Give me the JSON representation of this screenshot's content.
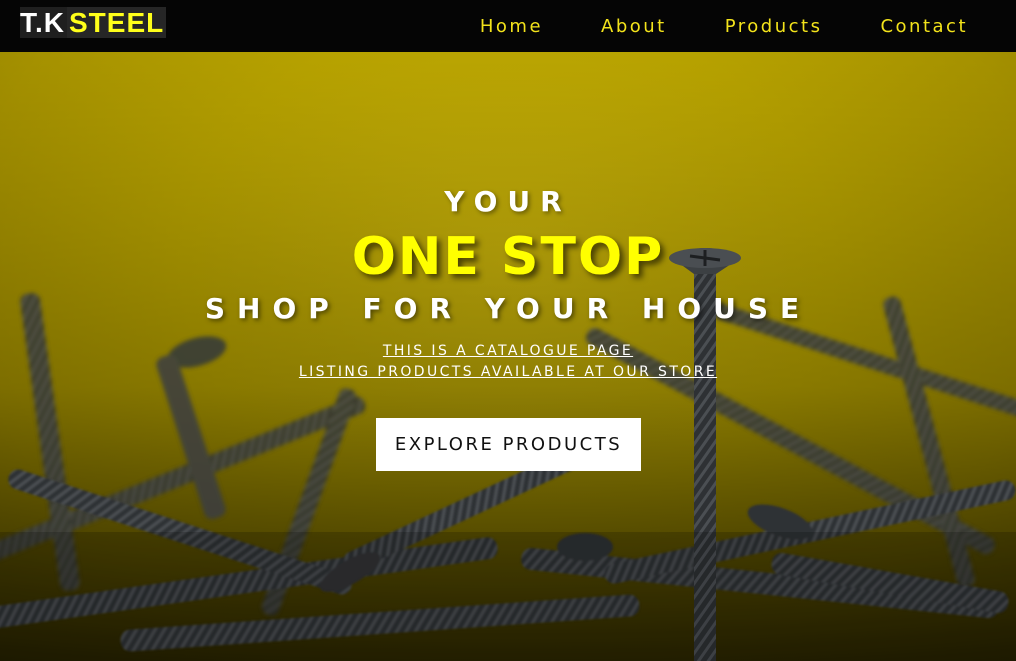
{
  "header": {
    "logo_part1": "T.K",
    "logo_part2": "STEEL",
    "nav": [
      {
        "label": "Home"
      },
      {
        "label": "About"
      },
      {
        "label": "Products"
      },
      {
        "label": "Contact"
      }
    ]
  },
  "hero": {
    "line1": "YOUR",
    "line2": "ONE STOP",
    "line3": "SHOP FOR YOUR HOUSE",
    "sub1": "THIS IS A CATALOGUE PAGE",
    "sub2": "LISTING PRODUCTS AVAILABLE AT OUR STORE",
    "cta_label": "EXPLORE PRODUCTS",
    "background_image": "screws-on-yellow"
  },
  "colors": {
    "nav_bg": "#050505",
    "accent_yellow": "#ffff00",
    "nav_link": "#f3e31b",
    "hero_bg": "#b7a200"
  }
}
